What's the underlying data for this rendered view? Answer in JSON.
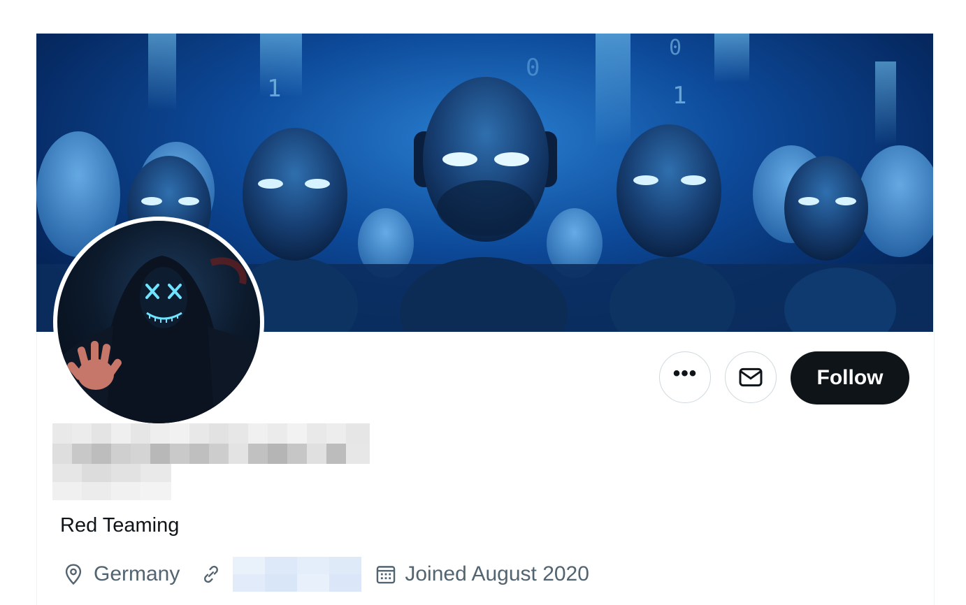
{
  "profile": {
    "bio": "Red Teaming",
    "location": "Germany",
    "joined": "Joined August 2020"
  },
  "actions": {
    "more_label": "•••",
    "follow_label": "Follow"
  },
  "icons": {
    "more": "more-icon",
    "message": "envelope-icon",
    "location": "location-pin-icon",
    "link": "link-icon",
    "calendar": "calendar-icon"
  },
  "colors": {
    "follow_bg": "#0f1419",
    "secondary_text": "#536471",
    "banner_blue": "#0d4a9a"
  }
}
